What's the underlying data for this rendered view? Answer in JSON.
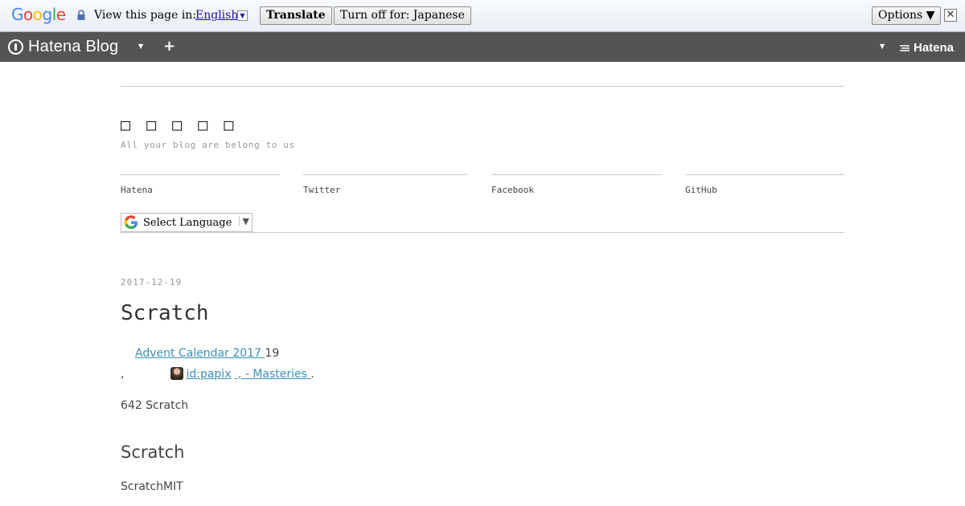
{
  "translate_bar": {
    "logo": "Google",
    "view_label": "View this page in:",
    "language": "English",
    "translate_button": "Translate",
    "turn_off_button": "Turn off for: Japanese",
    "options_button": "Options ▼",
    "close": "✕"
  },
  "toolbar": {
    "logo_text": "Hatena Blog",
    "caret": "▼",
    "plus": "+",
    "hatena_label": "Hatena"
  },
  "blog": {
    "title": "□ □ □ □ □",
    "description": "All your blog are belong to us",
    "nav": {
      "hatena": "Hatena",
      "twitter": "Twitter",
      "facebook": "Facebook",
      "github": "GitHub"
    },
    "select_language": "Select Language",
    "select_arrow": "▼"
  },
  "post": {
    "date": "2017-12-19",
    "title": "Scratch",
    "line1_link": " Advent Calendar 2017 ",
    "line1_suffix": " 19",
    "line2_prefix": ",",
    "line2_user_link": "id:papix",
    "line2_link2": " , - Masteries       ",
    "line2_suffix": ".",
    "paragraph1": "642 Scratch",
    "heading": "Scratch",
    "paragraph2": "ScratchMIT"
  },
  "colors": {
    "toolbar_bg": "#545454",
    "link": "#3a8fb7"
  }
}
